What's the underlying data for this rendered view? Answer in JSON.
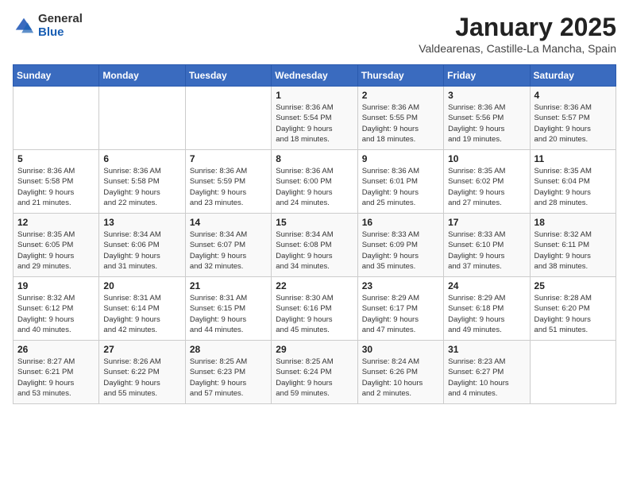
{
  "header": {
    "logo_general": "General",
    "logo_blue": "Blue",
    "month_year": "January 2025",
    "location": "Valdearenas, Castille-La Mancha, Spain"
  },
  "days_of_week": [
    "Sunday",
    "Monday",
    "Tuesday",
    "Wednesday",
    "Thursday",
    "Friday",
    "Saturday"
  ],
  "weeks": [
    [
      {
        "day": "",
        "info": ""
      },
      {
        "day": "",
        "info": ""
      },
      {
        "day": "",
        "info": ""
      },
      {
        "day": "1",
        "info": "Sunrise: 8:36 AM\nSunset: 5:54 PM\nDaylight: 9 hours\nand 18 minutes."
      },
      {
        "day": "2",
        "info": "Sunrise: 8:36 AM\nSunset: 5:55 PM\nDaylight: 9 hours\nand 18 minutes."
      },
      {
        "day": "3",
        "info": "Sunrise: 8:36 AM\nSunset: 5:56 PM\nDaylight: 9 hours\nand 19 minutes."
      },
      {
        "day": "4",
        "info": "Sunrise: 8:36 AM\nSunset: 5:57 PM\nDaylight: 9 hours\nand 20 minutes."
      }
    ],
    [
      {
        "day": "5",
        "info": "Sunrise: 8:36 AM\nSunset: 5:58 PM\nDaylight: 9 hours\nand 21 minutes."
      },
      {
        "day": "6",
        "info": "Sunrise: 8:36 AM\nSunset: 5:58 PM\nDaylight: 9 hours\nand 22 minutes."
      },
      {
        "day": "7",
        "info": "Sunrise: 8:36 AM\nSunset: 5:59 PM\nDaylight: 9 hours\nand 23 minutes."
      },
      {
        "day": "8",
        "info": "Sunrise: 8:36 AM\nSunset: 6:00 PM\nDaylight: 9 hours\nand 24 minutes."
      },
      {
        "day": "9",
        "info": "Sunrise: 8:36 AM\nSunset: 6:01 PM\nDaylight: 9 hours\nand 25 minutes."
      },
      {
        "day": "10",
        "info": "Sunrise: 8:35 AM\nSunset: 6:02 PM\nDaylight: 9 hours\nand 27 minutes."
      },
      {
        "day": "11",
        "info": "Sunrise: 8:35 AM\nSunset: 6:04 PM\nDaylight: 9 hours\nand 28 minutes."
      }
    ],
    [
      {
        "day": "12",
        "info": "Sunrise: 8:35 AM\nSunset: 6:05 PM\nDaylight: 9 hours\nand 29 minutes."
      },
      {
        "day": "13",
        "info": "Sunrise: 8:34 AM\nSunset: 6:06 PM\nDaylight: 9 hours\nand 31 minutes."
      },
      {
        "day": "14",
        "info": "Sunrise: 8:34 AM\nSunset: 6:07 PM\nDaylight: 9 hours\nand 32 minutes."
      },
      {
        "day": "15",
        "info": "Sunrise: 8:34 AM\nSunset: 6:08 PM\nDaylight: 9 hours\nand 34 minutes."
      },
      {
        "day": "16",
        "info": "Sunrise: 8:33 AM\nSunset: 6:09 PM\nDaylight: 9 hours\nand 35 minutes."
      },
      {
        "day": "17",
        "info": "Sunrise: 8:33 AM\nSunset: 6:10 PM\nDaylight: 9 hours\nand 37 minutes."
      },
      {
        "day": "18",
        "info": "Sunrise: 8:32 AM\nSunset: 6:11 PM\nDaylight: 9 hours\nand 38 minutes."
      }
    ],
    [
      {
        "day": "19",
        "info": "Sunrise: 8:32 AM\nSunset: 6:12 PM\nDaylight: 9 hours\nand 40 minutes."
      },
      {
        "day": "20",
        "info": "Sunrise: 8:31 AM\nSunset: 6:14 PM\nDaylight: 9 hours\nand 42 minutes."
      },
      {
        "day": "21",
        "info": "Sunrise: 8:31 AM\nSunset: 6:15 PM\nDaylight: 9 hours\nand 44 minutes."
      },
      {
        "day": "22",
        "info": "Sunrise: 8:30 AM\nSunset: 6:16 PM\nDaylight: 9 hours\nand 45 minutes."
      },
      {
        "day": "23",
        "info": "Sunrise: 8:29 AM\nSunset: 6:17 PM\nDaylight: 9 hours\nand 47 minutes."
      },
      {
        "day": "24",
        "info": "Sunrise: 8:29 AM\nSunset: 6:18 PM\nDaylight: 9 hours\nand 49 minutes."
      },
      {
        "day": "25",
        "info": "Sunrise: 8:28 AM\nSunset: 6:20 PM\nDaylight: 9 hours\nand 51 minutes."
      }
    ],
    [
      {
        "day": "26",
        "info": "Sunrise: 8:27 AM\nSunset: 6:21 PM\nDaylight: 9 hours\nand 53 minutes."
      },
      {
        "day": "27",
        "info": "Sunrise: 8:26 AM\nSunset: 6:22 PM\nDaylight: 9 hours\nand 55 minutes."
      },
      {
        "day": "28",
        "info": "Sunrise: 8:25 AM\nSunset: 6:23 PM\nDaylight: 9 hours\nand 57 minutes."
      },
      {
        "day": "29",
        "info": "Sunrise: 8:25 AM\nSunset: 6:24 PM\nDaylight: 9 hours\nand 59 minutes."
      },
      {
        "day": "30",
        "info": "Sunrise: 8:24 AM\nSunset: 6:26 PM\nDaylight: 10 hours\nand 2 minutes."
      },
      {
        "day": "31",
        "info": "Sunrise: 8:23 AM\nSunset: 6:27 PM\nDaylight: 10 hours\nand 4 minutes."
      },
      {
        "day": "",
        "info": ""
      }
    ]
  ]
}
